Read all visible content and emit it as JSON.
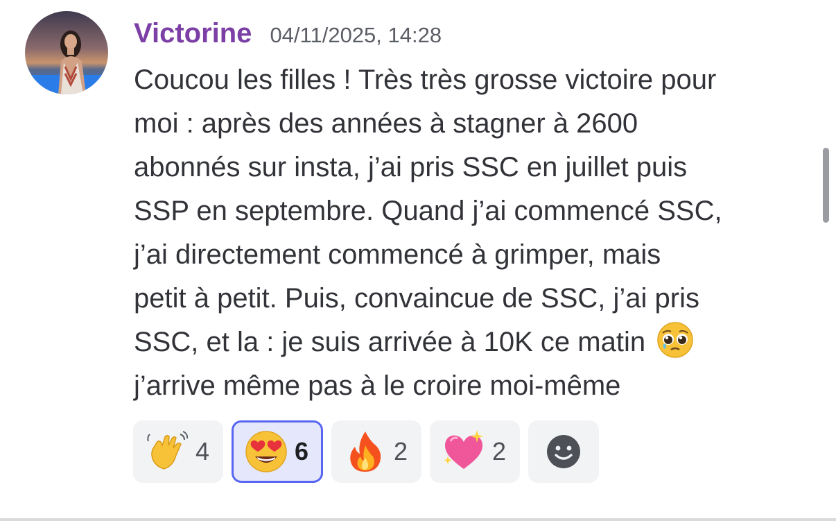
{
  "message": {
    "author": "Victorine",
    "timestamp": "04/11/2025, 14:28",
    "author_color": "#7b3fa6",
    "avatar": "user-photo-avatar",
    "lines": [
      "Coucou les filles ! Très très grosse victoire pour",
      "moi : après des années à stagner à 2600",
      "abonnés sur insta, j’ai pris SSC en juillet puis",
      "SSP en septembre. Quand j’ai commencé SSC,",
      "j’ai directement commencé à grimper, mais",
      "petit à petit. Puis, convaincue de SSC, j’ai pris",
      "SSC, et la : je suis arrivée à 10K ce matin",
      "j’arrive même pas à le croire moi-même"
    ],
    "inline_emoji": "pleading-face-emoji"
  },
  "reactions": [
    {
      "emoji": "waving-hand-emoji",
      "count": "4",
      "selected": false
    },
    {
      "emoji": "heart-eyes-emoji",
      "count": "6",
      "selected": true
    },
    {
      "emoji": "fire-emoji",
      "count": "2",
      "selected": false
    },
    {
      "emoji": "sparkling-heart-emoji",
      "count": "2",
      "selected": false
    }
  ],
  "add_reaction": {
    "icon": "smiley-add-reaction-icon"
  },
  "colors": {
    "selected_border": "#5865f2",
    "selected_bg": "#e5e8fc",
    "reaction_bg": "#f2f3f5",
    "text": "#313338"
  }
}
